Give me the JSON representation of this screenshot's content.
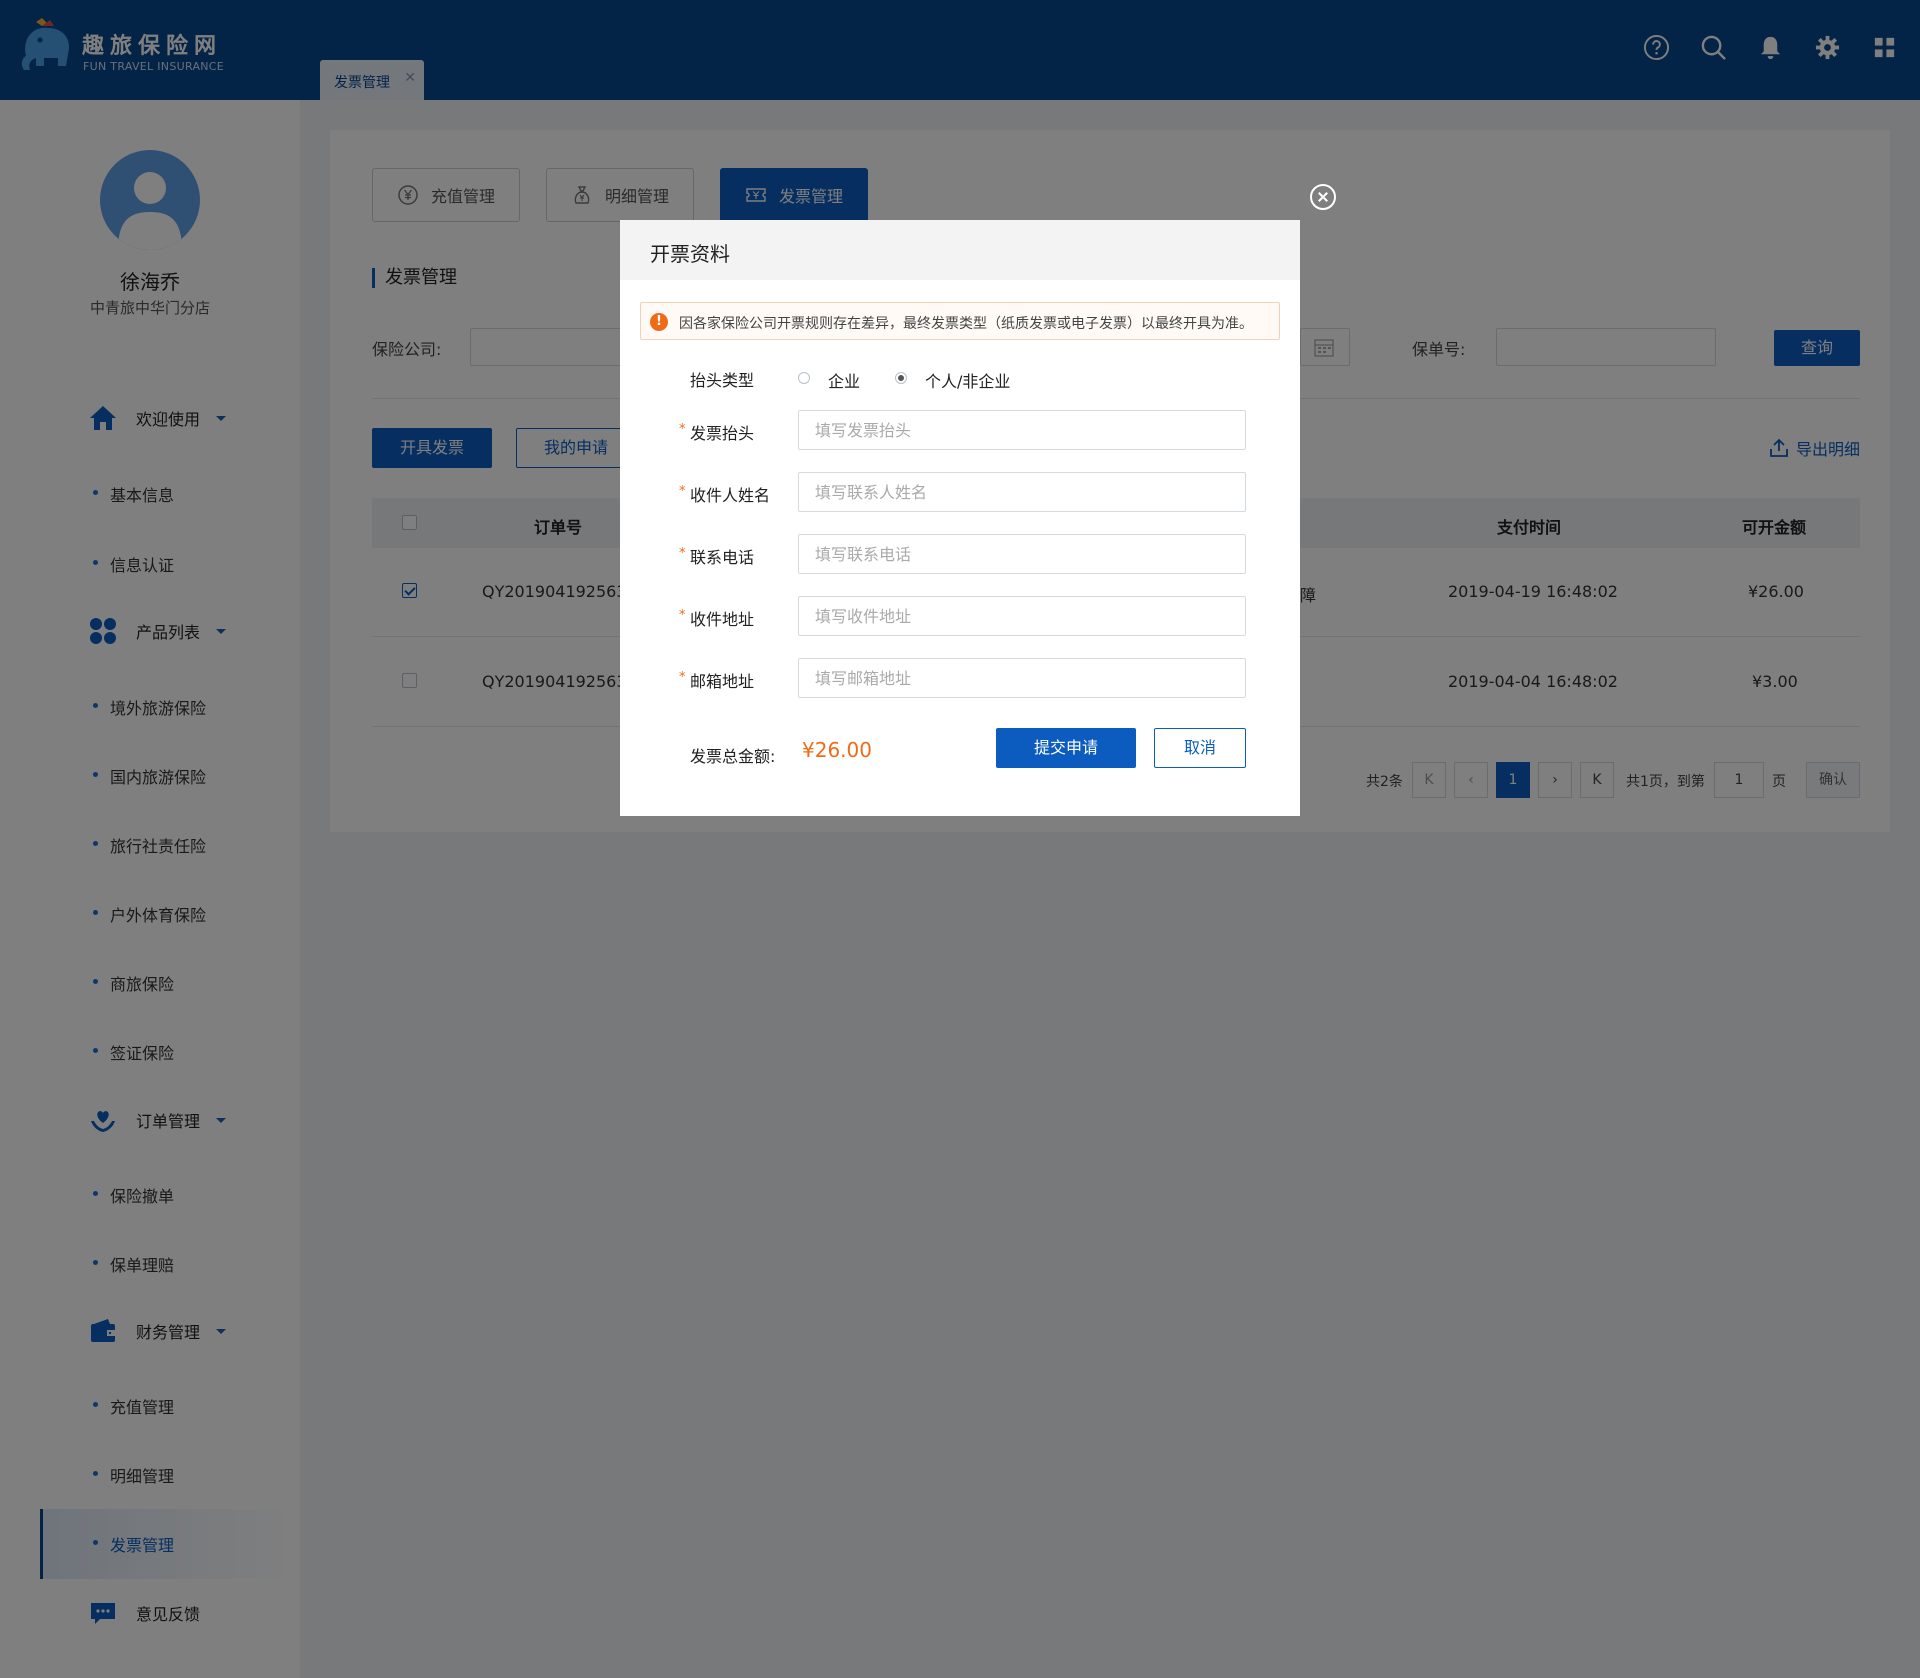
{
  "brand": {
    "name_cn": "趣旅保险网",
    "name_en": "FUN TRAVEL INSURANCE"
  },
  "header": {
    "open_tab": {
      "label": "发票管理",
      "close": "✕"
    },
    "icons": [
      "help-icon",
      "search-icon",
      "bell-icon",
      "settings-icon",
      "apps-grid-icon"
    ]
  },
  "user": {
    "name": "徐海乔",
    "org": "中青旅中华门分店"
  },
  "sidebar": {
    "groups": {
      "welcome": {
        "label": "欢迎使用",
        "icon": "home-icon"
      },
      "products": {
        "label": "产品列表",
        "icon": "grid-dots-icon"
      },
      "orders": {
        "label": "订单管理",
        "icon": "heart-hands-icon"
      },
      "finance": {
        "label": "财务管理",
        "icon": "wallet-icon"
      },
      "feedback": {
        "label": "意见反馈",
        "icon": "chat-icon"
      }
    },
    "items": {
      "basic_info": "基本信息",
      "verify": "信息认证",
      "overseas": "境外旅游保险",
      "domestic": "国内旅游保险",
      "agency": "旅行社责任险",
      "outdoor": "户外体育保险",
      "business": "商旅保险",
      "visa": "签证保险",
      "cancel": "保险撤单",
      "claim": "保单理赔",
      "recharge": "充值管理",
      "detail": "明细管理",
      "invoice": "发票管理"
    }
  },
  "main": {
    "tabs": {
      "recharge": "充值管理",
      "detail": "明细管理",
      "invoice": "发票管理"
    },
    "section_title": "发票管理",
    "filters": {
      "company_label": "保险公司:",
      "policy_label": "保单号:"
    },
    "query_button": "查询",
    "issue_button": "开具发票",
    "my_apply_button": "我的申请",
    "export_label": "导出明细",
    "table": {
      "headers": {
        "order_no": "订单号",
        "pay_time": "支付时间",
        "amount": "可开金额"
      },
      "rows": [
        {
          "order_no": "QY201904192563",
          "product_tail": "障",
          "pay_time": "2019-04-19  16:48:02",
          "amount": "¥26.00",
          "checked": true
        },
        {
          "order_no": "QY201904192563",
          "product_tail": "",
          "pay_time": "2019-04-04  16:48:02",
          "amount": "¥3.00",
          "checked": false
        }
      ]
    },
    "pagination": {
      "total": "共2条",
      "first": "K",
      "prev": "‹",
      "current": "1",
      "next": "›",
      "last": "K",
      "pages_goto": "共1页，到第",
      "page_input": "1",
      "page_unit": "页",
      "confirm": "确认"
    }
  },
  "modal": {
    "title": "开票资料",
    "notice": "因各家保险公司开票规则存在差异，最终发票类型（纸质发票或电子发票）以最终开具为准。",
    "title_type": {
      "label": "抬头类型",
      "options": [
        "企业",
        "个人/非企业"
      ],
      "selected": "个人/非企业"
    },
    "fields": {
      "invoice_title": {
        "label": "发票抬头",
        "placeholder": "填写发票抬头",
        "value": ""
      },
      "recipient": {
        "label": "收件人姓名",
        "placeholder": "填写联系人姓名",
        "value": ""
      },
      "phone": {
        "label": "联系电话",
        "placeholder": "填写联系电话",
        "value": ""
      },
      "address": {
        "label": "收件地址",
        "placeholder": "填写收件地址",
        "value": ""
      },
      "email": {
        "label": "邮箱地址",
        "placeholder": "填写邮箱地址",
        "value": ""
      }
    },
    "total_label": "发票总金额:",
    "total_value": "¥26.00",
    "submit": "提交申请",
    "cancel": "取消"
  },
  "colors": {
    "brand": "#07478f",
    "primary": "#0c5cc0",
    "accent": "#f06b17"
  }
}
